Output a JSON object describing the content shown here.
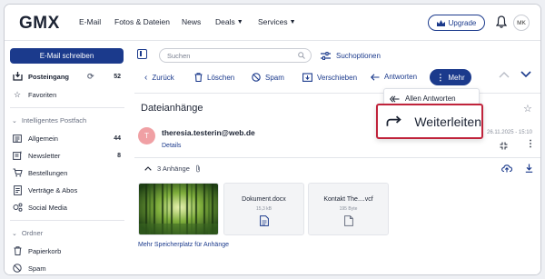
{
  "header": {
    "logo": "GMX",
    "nav": [
      "E-Mail",
      "Fotos & Dateien",
      "News",
      "Deals",
      "Services"
    ],
    "upgrade_label": "Upgrade",
    "avatar_initials": "MK"
  },
  "sidebar": {
    "compose_label": "E-Mail schreiben",
    "inbox": {
      "label": "Posteingang",
      "count": "52"
    },
    "favorites": "Favoriten",
    "smart_section": "Intelligentes Postfach",
    "smart_items": [
      {
        "label": "Allgemein",
        "count": "44"
      },
      {
        "label": "Newsletter",
        "count": "8"
      },
      {
        "label": "Bestellungen",
        "count": ""
      },
      {
        "label": "Verträge & Abos",
        "count": ""
      },
      {
        "label": "Social Media",
        "count": ""
      }
    ],
    "folder_section": "Ordner",
    "folder_items": [
      {
        "label": "Papierkorb"
      },
      {
        "label": "Spam"
      }
    ]
  },
  "search": {
    "placeholder": "Suchen",
    "options_label": "Suchoptionen"
  },
  "toolbar": {
    "back": "Zurück",
    "delete": "Löschen",
    "spam": "Spam",
    "move": "Verschieben",
    "reply": "Antworten",
    "more": "Mehr"
  },
  "dropdown": {
    "reply_all": "Allen Antworten",
    "forward": "Weiterleiten"
  },
  "message": {
    "subject": "Dateianhänge",
    "avatar_letter": "T",
    "sender": "theresia.testerin@web.de",
    "details_label": "Details",
    "date": "26.11.2025 - 15:10",
    "attachments_label": "3 Anhänge",
    "attachments": [
      {
        "name": "",
        "size": ""
      },
      {
        "name": "Dokument.docx",
        "size": "15,3 kB"
      },
      {
        "name": "Kontakt The....vcf",
        "size": "195 Byte"
      }
    ],
    "more_storage": "Mehr Speicherplatz für Anhänge"
  },
  "colors": {
    "brand": "#1b3a8c",
    "highlight_border": "#c0233b",
    "avatar_bg": "#f0a0a4"
  }
}
